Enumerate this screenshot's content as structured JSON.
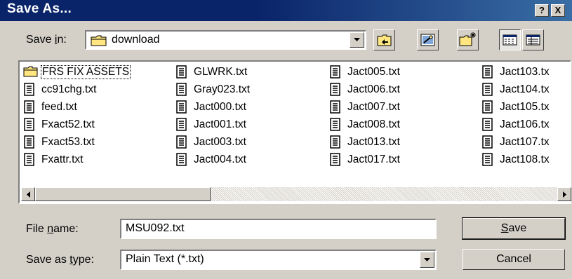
{
  "title": "Save As...",
  "title_buttons": {
    "help": "?",
    "close": "X"
  },
  "save_in": {
    "label_pre": "Save ",
    "label_ul": "i",
    "label_post": "n:",
    "value": "download"
  },
  "files": [
    {
      "name": "FRS FIX ASSETS",
      "type": "folder",
      "selected": true
    },
    {
      "name": "cc91chg.txt",
      "type": "file"
    },
    {
      "name": "feed.txt",
      "type": "file"
    },
    {
      "name": "Fxact52.txt",
      "type": "file"
    },
    {
      "name": "Fxact53.txt",
      "type": "file"
    },
    {
      "name": "Fxattr.txt",
      "type": "file"
    },
    {
      "name": "GLWRK.txt",
      "type": "file"
    },
    {
      "name": "Gray023.txt",
      "type": "file"
    },
    {
      "name": "Jact000.txt",
      "type": "file"
    },
    {
      "name": "Jact001.txt",
      "type": "file"
    },
    {
      "name": "Jact003.txt",
      "type": "file"
    },
    {
      "name": "Jact004.txt",
      "type": "file"
    },
    {
      "name": "Jact005.txt",
      "type": "file"
    },
    {
      "name": "Jact006.txt",
      "type": "file"
    },
    {
      "name": "Jact007.txt",
      "type": "file"
    },
    {
      "name": "Jact008.txt",
      "type": "file"
    },
    {
      "name": "Jact013.txt",
      "type": "file"
    },
    {
      "name": "Jact017.txt",
      "type": "file"
    },
    {
      "name": "Jact103.tx",
      "type": "file"
    },
    {
      "name": "Jact104.tx",
      "type": "file"
    },
    {
      "name": "Jact105.tx",
      "type": "file"
    },
    {
      "name": "Jact106.tx",
      "type": "file"
    },
    {
      "name": "Jact107.tx",
      "type": "file"
    },
    {
      "name": "Jact108.tx",
      "type": "file"
    }
  ],
  "file_name": {
    "label_pre": "File ",
    "label_ul": "n",
    "label_post": "ame:",
    "value": "MSU092.txt"
  },
  "save_as_type": {
    "label_pre": "Save as ",
    "label_ul": "t",
    "label_post": "ype:",
    "value": "Plain Text (*.txt)"
  },
  "buttons": {
    "save_ul": "S",
    "save_rest": "ave",
    "cancel": "Cancel"
  }
}
